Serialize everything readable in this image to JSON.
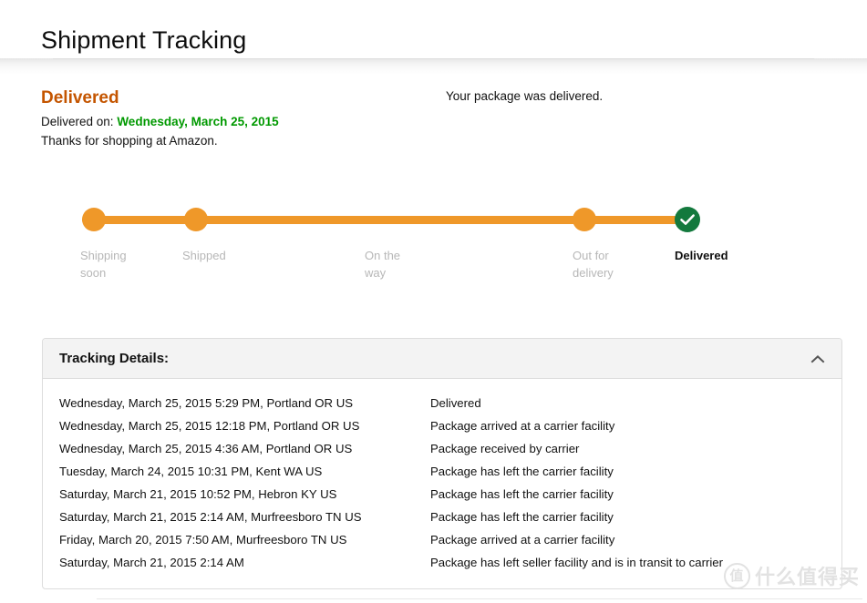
{
  "page": {
    "title": "Shipment Tracking"
  },
  "status": {
    "headline": "Delivered",
    "delivered_on_label": "Delivered on:",
    "delivered_on_date": "Wednesday, March 25, 2015",
    "thanks": "Thanks for shopping at Amazon.",
    "note": "Your package was delivered.",
    "headline_color": "#c45500",
    "date_color": "#009900"
  },
  "tracker": {
    "bar_color": "#ef9829",
    "complete_color": "#13793d",
    "inactive_label_color": "#b7b7b7",
    "steps": [
      {
        "label": "Shipping soon",
        "state": "done"
      },
      {
        "label": "Shipped",
        "state": "done"
      },
      {
        "label": "On the way",
        "state": "done"
      },
      {
        "label": "Out for delivery",
        "state": "done"
      },
      {
        "label": "Delivered",
        "state": "current"
      }
    ]
  },
  "details": {
    "title": "Tracking Details:",
    "toggle_icon": "chevron-up-icon",
    "rows": [
      {
        "when": "Wednesday, March 25, 2015 5:29 PM, Portland OR US",
        "what": "Delivered"
      },
      {
        "when": "Wednesday, March 25, 2015 12:18 PM, Portland OR US",
        "what": "Package arrived at a carrier facility"
      },
      {
        "when": "Wednesday, March 25, 2015 4:36 AM, Portland OR US",
        "what": "Package received by carrier"
      },
      {
        "when": "Tuesday, March 24, 2015 10:31 PM, Kent WA US",
        "what": "Package has left the carrier facility"
      },
      {
        "when": "Saturday, March 21, 2015 10:52 PM, Hebron KY US",
        "what": "Package has left the carrier facility"
      },
      {
        "when": "Saturday, March 21, 2015 2:14 AM, Murfreesboro TN US",
        "what": "Package has left the carrier facility"
      },
      {
        "when": "Friday, March 20, 2015 7:50 AM, Murfreesboro TN US",
        "what": "Package arrived at a carrier facility"
      },
      {
        "when": "Saturday, March 21, 2015 2:14 AM",
        "what": "Package has left seller facility and is in transit to carrier"
      }
    ]
  },
  "watermark": {
    "badge": "值",
    "text": "什么值得买"
  }
}
